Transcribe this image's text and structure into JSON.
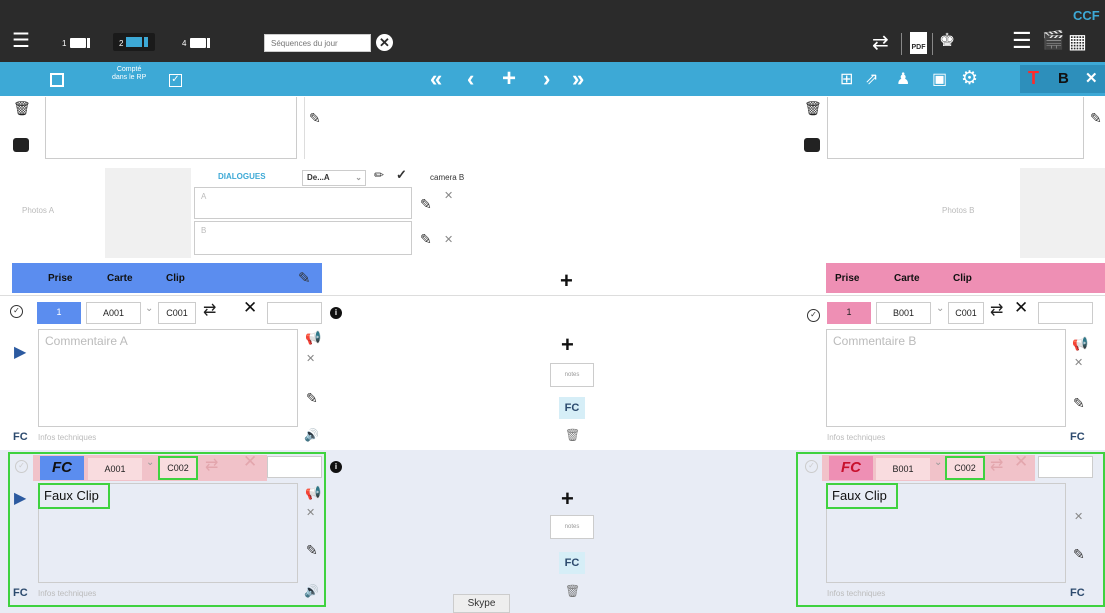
{
  "top": {
    "brand": "CCF",
    "cam_nums": [
      "1",
      "2",
      "4"
    ],
    "search_placeholder": "Séquences du jour"
  },
  "blue": {
    "counted_label_1": "Compté",
    "counted_label_2": "dans le RP",
    "t_btn": "T",
    "b_btn": "B"
  },
  "dialogues": {
    "title": "DIALOGUES",
    "select_value": "De...A",
    "camera_label": "camera B",
    "field_a": "A",
    "field_b": "B",
    "photos_a": "Photos A",
    "photos_b": "Photos B"
  },
  "cols": {
    "prise": "Prise",
    "carte": "Carte",
    "clip": "Clip"
  },
  "left": {
    "row1": {
      "prise": "1",
      "carte": "A001",
      "clip": "C001",
      "comment_placeholder": "Commentaire A",
      "infos": "Infos techniques"
    },
    "row2": {
      "prise": "FC",
      "carte": "A001",
      "clip": "C002",
      "comment": "Faux Clip",
      "infos": "Infos techniques"
    }
  },
  "right": {
    "row1": {
      "prise": "1",
      "carte": "B001",
      "clip": "C001",
      "comment_placeholder": "Commentaire B",
      "infos": "Infos techniques"
    },
    "row2": {
      "prise": "FC",
      "carte": "B001",
      "clip": "C002",
      "comment": "Faux Clip",
      "infos": "Infos techniques"
    }
  },
  "center": {
    "notes_label": "notes",
    "fc": "FC"
  },
  "fc_label": "FC",
  "skype": "Skype"
}
